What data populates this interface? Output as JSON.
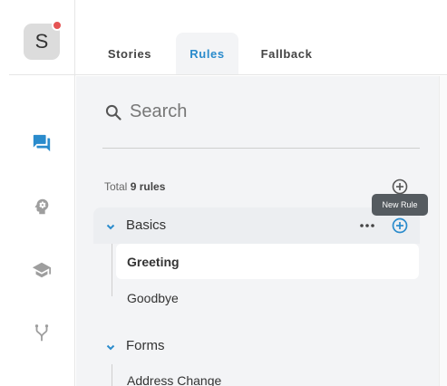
{
  "avatar": {
    "letter": "S",
    "notification": true
  },
  "rail": {
    "items": [
      {
        "icon": "chat-icon",
        "active": true
      },
      {
        "icon": "head-gear-icon",
        "active": false
      },
      {
        "icon": "graduation-cap-icon",
        "active": false
      },
      {
        "icon": "fork-icon",
        "active": false
      }
    ]
  },
  "tabs": [
    {
      "label": "Stories",
      "active": false
    },
    {
      "label": "Rules",
      "active": true
    },
    {
      "label": "Fallback",
      "active": false
    }
  ],
  "search": {
    "placeholder": "Search"
  },
  "summary": {
    "prefix": "Total",
    "count_label": "9 rules"
  },
  "tooltip": {
    "text": "New Rule"
  },
  "groups": [
    {
      "name": "Basics",
      "expanded": true,
      "rules": [
        "Greeting",
        "Goodbye"
      ],
      "selected_rule": "Greeting"
    },
    {
      "name": "Forms",
      "expanded": true,
      "rules": [
        "Address Change"
      ]
    }
  ],
  "colors": {
    "accent": "#2a8bcc",
    "notification": "#e55353",
    "rail_icon_inactive": "#9e9e9e"
  }
}
